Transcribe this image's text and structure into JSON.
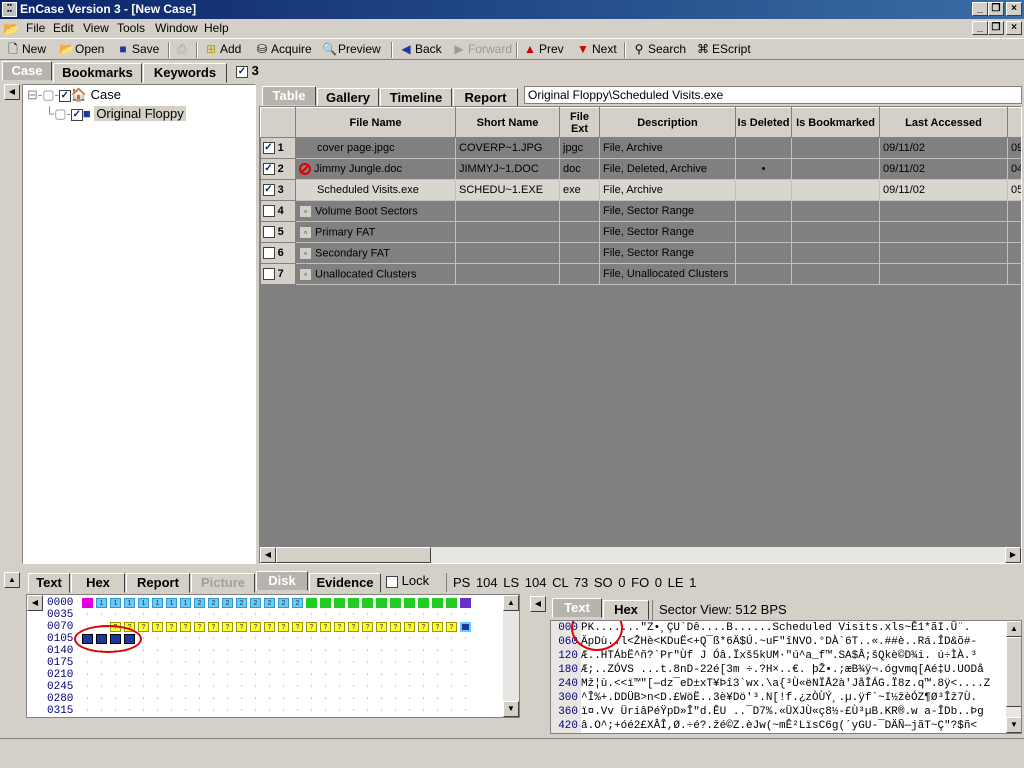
{
  "window": {
    "title": "EnCase Version 3 - [New Case]"
  },
  "menu": [
    "File",
    "Edit",
    "View",
    "Tools",
    "Window",
    "Help"
  ],
  "toolbar": {
    "new": "New",
    "open": "Open",
    "save": "Save",
    "add": "Add",
    "acquire": "Acquire",
    "preview": "Preview",
    "back": "Back",
    "forward": "Forward",
    "prev": "Prev",
    "next": "Next",
    "search": "Search",
    "escript": "EScript"
  },
  "left_tabs": {
    "case": "Case",
    "bookmarks": "Bookmarks",
    "keywords": "Keywords",
    "count": "3"
  },
  "tree": {
    "root": "Case",
    "child": "Original Floppy"
  },
  "right_tabs": {
    "table": "Table",
    "gallery": "Gallery",
    "timeline": "Timeline",
    "report": "Report",
    "path": "Original Floppy\\Scheduled Visits.exe"
  },
  "columns": [
    "File Name",
    "Short Name",
    "File Ext",
    "Description",
    "Is Deleted",
    "Is Bookmarked",
    "Last Accessed",
    ""
  ],
  "rows": [
    {
      "n": "1",
      "name": "cover page.jpgc",
      "short": "COVERP~1.JPG",
      "ext": "jpgc",
      "desc": "File, Archive",
      "deleted": "",
      "bm": "",
      "acc": "09/11/02",
      "extra": "09",
      "checked": true
    },
    {
      "n": "2",
      "name": "Jimmy Jungle.doc",
      "short": "JIMMYJ~1.DOC",
      "ext": "doc",
      "desc": "File, Deleted, Archive",
      "deleted": "•",
      "bm": "",
      "acc": "09/11/02",
      "extra": "04",
      "checked": true
    },
    {
      "n": "3",
      "name": "Scheduled Visits.exe",
      "short": "SCHEDU~1.EXE",
      "ext": "exe",
      "desc": "File, Archive",
      "deleted": "",
      "bm": "",
      "acc": "09/11/02",
      "extra": "05",
      "checked": true
    },
    {
      "n": "4",
      "name": "Volume Boot Sectors",
      "short": "",
      "ext": "",
      "desc": "File, Sector Range",
      "deleted": "",
      "bm": "",
      "acc": "",
      "extra": "",
      "checked": false
    },
    {
      "n": "5",
      "name": "Primary FAT",
      "short": "",
      "ext": "",
      "desc": "File, Sector Range",
      "deleted": "",
      "bm": "",
      "acc": "",
      "extra": "",
      "checked": false
    },
    {
      "n": "6",
      "name": "Secondary FAT",
      "short": "",
      "ext": "",
      "desc": "File, Sector Range",
      "deleted": "",
      "bm": "",
      "acc": "",
      "extra": "",
      "checked": false
    },
    {
      "n": "7",
      "name": "Unallocated Clusters",
      "short": "",
      "ext": "",
      "desc": "File, Unallocated Clusters",
      "deleted": "",
      "bm": "",
      "acc": "",
      "extra": "",
      "checked": false
    }
  ],
  "bottom_tabs": {
    "text": "Text",
    "hex": "Hex",
    "report": "Report",
    "picture": "Picture",
    "disk": "Disk",
    "evidence": "Evidence",
    "lock": "Lock"
  },
  "disk_status": "PS 104  LS 104  CL 73  SO 0  FO 0  LE 1",
  "disk_rows": [
    "0000",
    "0035",
    "0070",
    "0105",
    "0140",
    "0175",
    "0210",
    "0245",
    "0280",
    "0315"
  ],
  "view_tabs": {
    "text": "Text",
    "hex": "Hex",
    "sector_view": "Sector View: 512 BPS"
  },
  "hex_lines": [
    {
      "off": "000",
      "text": "PK.......\"Z•¸ÇU`Dê....B......Scheduled Visits.xls~Ê1*ãI.Û¨."
    },
    {
      "off": "060",
      "text": "ÄpDù..l<ŽHè<KDuË<+Q¯ß*6Ä$Ú.~uF\"îNVO.°DÀ`6T..«.##è..Rá.ÎD&õ#-"
    },
    {
      "off": "120",
      "text": "Æ..HTÁbË^ñ?`Pr\"Ùf J Óâ.Ïxš5kUM·\"ú^a_f™.SA$Â;šQkè©D¾i. ú÷ÌÀ.³"
    },
    {
      "off": "180",
      "text": "Æ;..ZÓVS ...t.8nD-22é[3m ÷.?H×..€. þŽ•.;æB¾ÿ¬.ógvmq[Aé‡U.UODå"
    },
    {
      "off": "240",
      "text": "Mž¦ù.<<ï™\"[—dz¯eD±xT¥Þî3`wx.\\a{³Ù«ëNÏÅ2à'JåÎÁG.Ï8z.q™.8ÿ<....Z"
    },
    {
      "off": "300",
      "text": "^Î%+.DDÜB>n<D.£WöË..3è¥Dö'³.N[!f.¿zÒÙÝ¸.µ.ÿf`~I½žèÓZ¶Ø³Îž7Ù."
    },
    {
      "off": "360",
      "text": "ï¤.Vv ÜriâPéŸpD»Î\"d.ÊU ..¯D7%.«ÜXJÙ«ç8½-£Ù³µB.KR®.w a-ÎDb..Þg"
    },
    {
      "off": "420",
      "text": "â.O^;+óé2£XÂÎ,Ø.÷é?.žé©Z.èJw(~mÊ²LïsC6g(´yGU-¯DÄÑ—jãT~Ç\"?$ñ<"
    }
  ]
}
